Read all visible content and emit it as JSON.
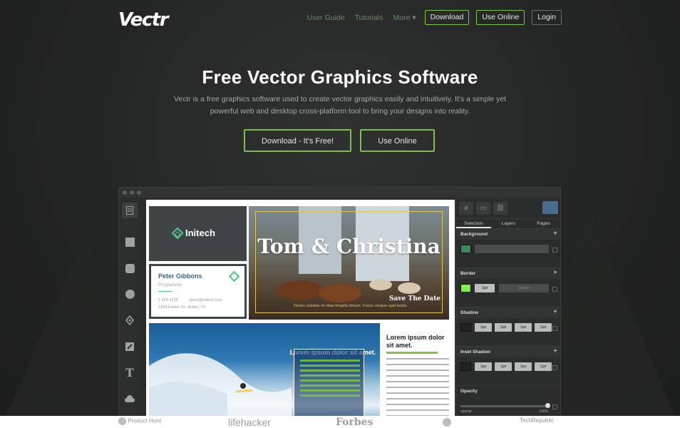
{
  "header": {
    "logo": "Vectr",
    "nav_links": [
      "User Guide",
      "Tutorials",
      "More"
    ],
    "buttons": {
      "download": "Download",
      "use_online": "Use Online",
      "login": "Login"
    }
  },
  "hero": {
    "title": "Free Vector Graphics Software",
    "subtitle": "Vectr is a free graphics software used to create vector graphics easily and intuitively. It's a simple yet powerful web and desktop cross-platform tool to bring your designs into reality.",
    "cta_download": "Download - It's Free!",
    "cta_online": "Use Online"
  },
  "app": {
    "panel_tabs": [
      "Selection",
      "Layers",
      "Pages"
    ],
    "sections": {
      "background": "Background",
      "border": "Border",
      "border_value": "1px",
      "border_align": "Center",
      "shadow": "Shadow",
      "inset_shadow": "Inset Shadow",
      "opacity": "Opacity",
      "opacity_label": "opacity",
      "opacity_value": "100%",
      "px": "1px"
    },
    "canvas": {
      "brand": "Initech",
      "card_name": "Peter Gibbons",
      "card_role": "Programmer",
      "card_phone": "1 555 4235",
      "card_mail": "peter@initech.com",
      "card_addr": "1234 Fowler St., Austin, TX",
      "photo_title": "Tom & Christina",
      "photo_save": "Save The Date",
      "photo_caption": "Donec sodales mi vitae fringilla dictum. Fusce congue eget turpis.",
      "surf_title": "Lorem ipsum dolor sit amet.",
      "side_title": "Lorem ipsum dolor sit amet."
    },
    "colors": {
      "accent": "#7cc543",
      "swatch_bg": "#3a8b5c",
      "swatch_border": "#7cf241"
    }
  },
  "press": [
    "Product Hunt",
    "lifehacker",
    "Forbes",
    "TechRepublic"
  ]
}
